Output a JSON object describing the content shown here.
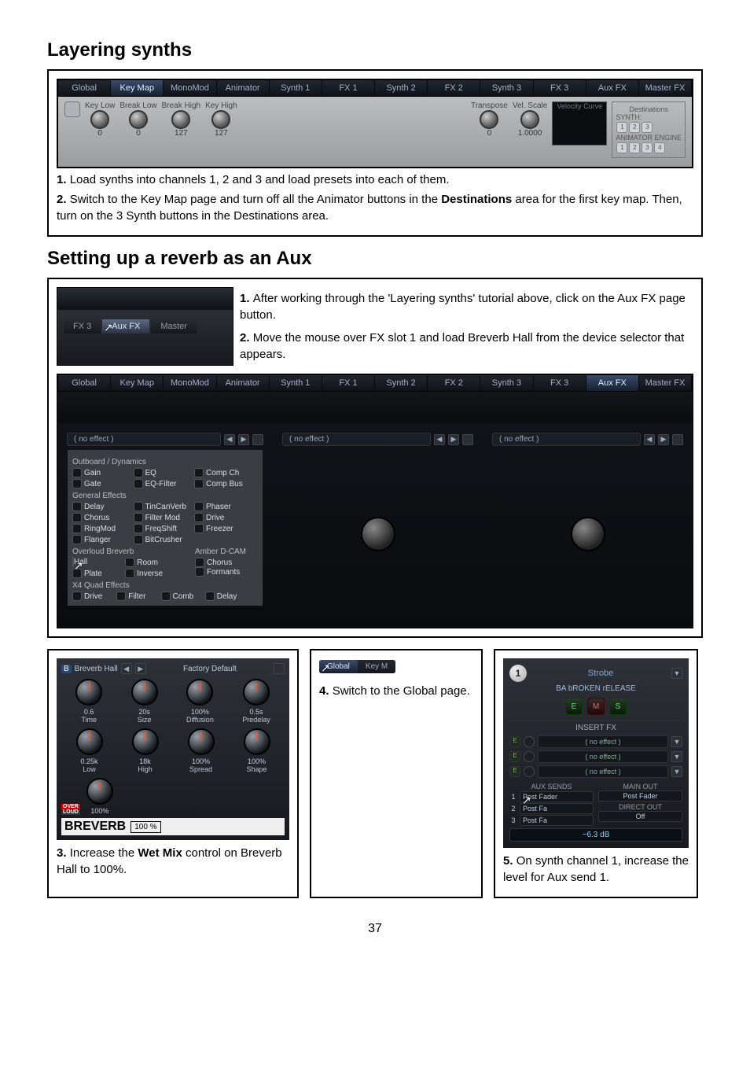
{
  "page_number": "37",
  "section1": {
    "title": "Layering synths",
    "tabs": [
      "Global",
      "Key Map",
      "MonoMod",
      "Animator",
      "Synth 1",
      "FX 1",
      "Synth 2",
      "FX 2",
      "Synth 3",
      "FX 3",
      "Aux FX",
      "Master FX"
    ],
    "active_tab": "Key Map",
    "knobs": [
      {
        "label": "Key Low",
        "val": "0"
      },
      {
        "label": "Break Low",
        "val": "0"
      },
      {
        "label": "Break High",
        "val": "127"
      },
      {
        "label": "Key High",
        "val": "127"
      }
    ],
    "knobs2": [
      {
        "label": "Transpose",
        "val": "0"
      },
      {
        "label": "Vel. Scale",
        "val": "1.0000"
      }
    ],
    "vel_curve": "Velocity Curve",
    "dest_title": "Destinations",
    "dest_synth": "SYNTH:",
    "dest_anim": "ANIMATOR ENGINE",
    "step1": "Load synths into channels 1, 2 and 3 and load presets into each of them.",
    "step2a": "Switch to the Key Map page and turn off all the Animator buttons in the ",
    "step2b": "Destinations",
    "step2c": " area for the first key map. Then, turn on the 3 Synth buttons in the Destinations area."
  },
  "section2": {
    "title": "Setting up a reverb as an Aux",
    "left_tabs": {
      "fx3": "FX 3",
      "aux": "Aux FX",
      "master": "Master"
    },
    "step1": "After working through the 'Layering synths' tutorial above, click on the Aux FX page button.",
    "step2": "Move the mouse over FX slot 1 and load Breverb Hall from the device selector that appears.",
    "tabs": [
      "Global",
      "Key Map",
      "MonoMod",
      "Animator",
      "Synth 1",
      "FX 1",
      "Synth 2",
      "FX 2",
      "Synth 3",
      "FX 3",
      "Aux FX",
      "Master FX"
    ],
    "active_tab": "Aux FX",
    "slot_name": "( no effect )",
    "fx_menu": {
      "cat1": "Outboard / Dynamics",
      "items1": [
        "Gain",
        "EQ",
        "Comp Ch",
        "Gate",
        "EQ-Filter",
        "Comp Bus"
      ],
      "cat2": "General Effects",
      "items2": [
        "Delay",
        "TinCanVerb",
        "Phaser",
        "Chorus",
        "Filter Mod",
        "Drive",
        "RingMod",
        "FreqShift",
        "Freezer",
        "Flanger",
        "BitCrusher"
      ],
      "cat3": "Overloud Breverb",
      "items3": [
        "Hall",
        "Room",
        "Plate",
        "Inverse"
      ],
      "cat3b": "Amber D-CAM",
      "items3b": [
        "Chorus",
        "Formants"
      ],
      "cat4": "X4 Quad Effects",
      "items4": [
        "Drive",
        "Filter",
        "Comb",
        "Delay"
      ]
    }
  },
  "breverb": {
    "head_b": "B",
    "name": "Breverb Hall",
    "preset": "Factory Default",
    "knobs_r1": [
      {
        "lab": "Time",
        "val": "0.6"
      },
      {
        "lab": "Size",
        "val": "20s"
      },
      {
        "lab": "Diffusion",
        "val": "100%"
      },
      {
        "lab": "Predelay",
        "val": "0.5s"
      }
    ],
    "knobs_r2": [
      {
        "lab": "Low",
        "val": "0.25k"
      },
      {
        "lab": "High",
        "val": "18k"
      },
      {
        "lab": "Spread",
        "val": "100%"
      },
      {
        "lab": "Shape",
        "val": "100%"
      }
    ],
    "brand": "BREVERB",
    "wet": "100 %",
    "step3a": "Increase the ",
    "step3b": "Wet Mix",
    "step3c": " control on Breverb Hall to 100%."
  },
  "mid": {
    "tabs": [
      "Global",
      "Key M"
    ],
    "step4": "Switch to the Global page."
  },
  "chan": {
    "num": "1",
    "strobe": "Strobe",
    "preset": "BA bROKEN rELEASE",
    "btns": [
      "E",
      "M",
      "S"
    ],
    "insert_fx": "INSERT FX",
    "no_effect": "( no effect )",
    "aux_title": "AUX SENDS",
    "main_title": "MAIN OUT",
    "post_fader": "Post Fader",
    "post_fa": "Post Fa",
    "direct": "DIRECT OUT",
    "off": "Off",
    "db": "−6.3 dB",
    "step5": "On synth channel 1, increase the level for Aux send 1."
  }
}
